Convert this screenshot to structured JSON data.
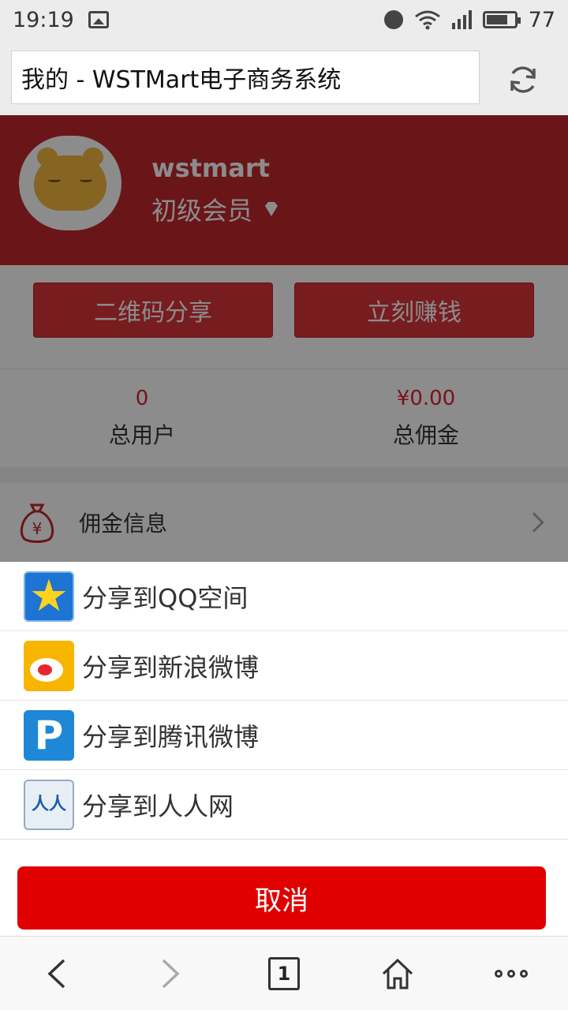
{
  "status_bar": {
    "time": "19:19",
    "battery": "77"
  },
  "browser": {
    "title": "我的 - WSTMart电子商务系统",
    "tab_count": "1"
  },
  "profile": {
    "username": "wstmart",
    "member_level": "初级会员"
  },
  "actions": {
    "qr_share": "二维码分享",
    "earn_now": "立刻赚钱"
  },
  "stats": [
    {
      "value": "0",
      "label": "总用户"
    },
    {
      "value": "¥0.00",
      "label": "总佣金"
    }
  ],
  "list": {
    "commission_info": "佣金信息"
  },
  "share_sheet": {
    "items": [
      {
        "label": "分享到QQ空间",
        "icon": "qzone-icon"
      },
      {
        "label": "分享到新浪微博",
        "icon": "sina-weibo-icon"
      },
      {
        "label": "分享到腾讯微博",
        "icon": "tencent-weibo-icon"
      },
      {
        "label": "分享到人人网",
        "icon": "renren-icon"
      }
    ],
    "cancel": "取消"
  },
  "colors": {
    "brand_red": "#c1272d",
    "cancel_red": "#e00000",
    "overlay": "rgba(0,0,0,0.45)"
  }
}
